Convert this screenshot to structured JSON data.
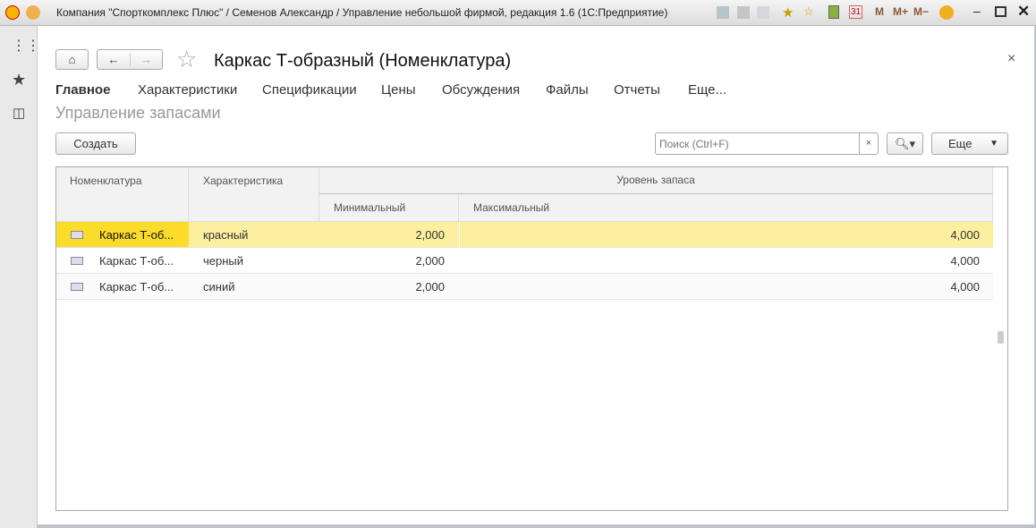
{
  "window": {
    "title": "Компания \"Спорткомплекс Плюс\" / Семенов Александр / Управление небольшой фирмой, редакция 1.6  (1С:Предприятие)",
    "tools": [
      "M",
      "M+",
      "M−"
    ],
    "calendar": "31"
  },
  "form": {
    "title": "Каркас Т-образный (Номенклатура)",
    "close": "×"
  },
  "tabs": [
    "Главное",
    "Характеристики",
    "Спецификации",
    "Цены",
    "Обсуждения",
    "Файлы",
    "Отчеты",
    "Еще..."
  ],
  "section": "Управление запасами",
  "toolbar": {
    "create": "Создать",
    "search_placeholder": "Поиск (Ctrl+F)",
    "clear": "×",
    "more": "Еще"
  },
  "table": {
    "headers": {
      "item": "Номенклатура",
      "characteristic": "Характеристика",
      "level": "Уровень запаса",
      "min": "Минимальный",
      "max": "Максимальный"
    },
    "rows": [
      {
        "item": "Каркас Т-об...",
        "characteristic": "красный",
        "min": "2,000",
        "max": "4,000"
      },
      {
        "item": "Каркас Т-об...",
        "characteristic": "черный",
        "min": "2,000",
        "max": "4,000"
      },
      {
        "item": "Каркас Т-об...",
        "characteristic": "синий",
        "min": "2,000",
        "max": "4,000"
      }
    ]
  },
  "colors": {
    "selected_cell": "#fbdc2a",
    "selected_row": "#fcf0a0"
  }
}
